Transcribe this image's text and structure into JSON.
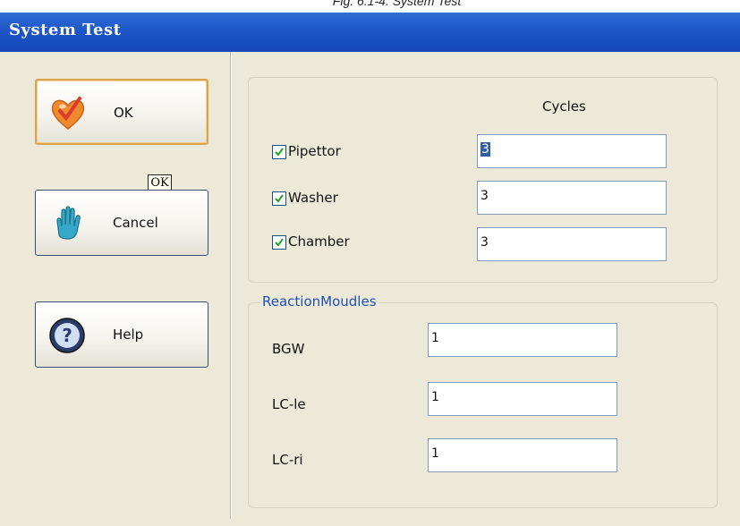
{
  "caption": "Fig. 6.1-4. System Test",
  "window": {
    "title": "System Test"
  },
  "buttons": {
    "ok": {
      "label": "OK",
      "icon": "heart-check-icon"
    },
    "cancel": {
      "label": "Cancel",
      "icon": "hand-stop-icon"
    },
    "help": {
      "label": "Help",
      "icon": "question-help-icon"
    }
  },
  "ok_tooltip": "OK",
  "cycles": {
    "header": "Cycles",
    "items": [
      {
        "label": "Pipettor",
        "checked": true,
        "value": "3"
      },
      {
        "label": "Washer",
        "checked": true,
        "value": "3"
      },
      {
        "label": "Chamber",
        "checked": true,
        "value": "3"
      }
    ]
  },
  "reaction_modules": {
    "legend": "ReactionMoudles",
    "items": [
      {
        "label": "BGW",
        "value": "1"
      },
      {
        "label": "LC-le",
        "value": "1"
      },
      {
        "label": "LC-ri",
        "value": "1"
      }
    ]
  },
  "colors": {
    "title_bar": "#1d57c8",
    "face": "#ece9d8",
    "legend_text": "#1f4fb5",
    "default_button_border": "#d9a44d",
    "selection": "#315fa6"
  }
}
